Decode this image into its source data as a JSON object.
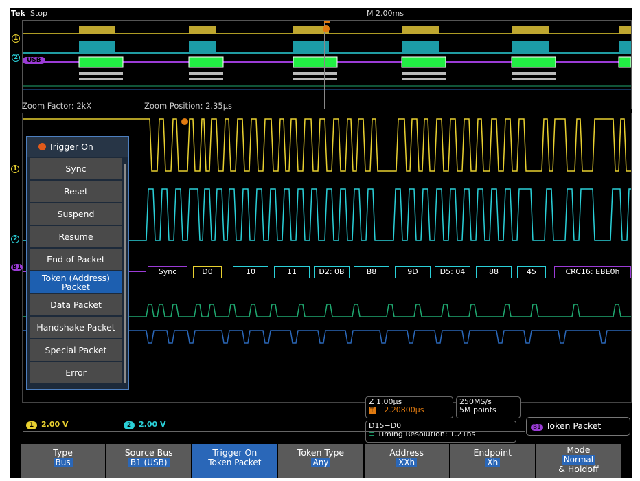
{
  "top_bar": {
    "brand": "Tek",
    "acq_state": "Stop",
    "horizontal_scale": "M 2.00ms"
  },
  "overview": {
    "bus_label": "USB"
  },
  "zoom": {
    "factor": "Zoom Factor: 2kX",
    "position": "Zoom Position: 2.35µs"
  },
  "bus_decode": [
    "Sync",
    "D0",
    "10",
    "11",
    "D2: 0B",
    "B8",
    "9D",
    "D5: 04",
    "88",
    "45",
    "CRC16: EBE0h"
  ],
  "trigger_menu": {
    "title": "Trigger On",
    "items": [
      "Sync",
      "Reset",
      "Suspend",
      "Resume",
      "End of Packet",
      "Token (Address) Packet",
      "Data Packet",
      "Handshake Packet",
      "Special Packet",
      "Error"
    ],
    "selected_index": 5
  },
  "channels": {
    "ch1_label": "1",
    "ch1_volts": "2.00 V",
    "ch2_label": "2",
    "ch2_volts": "2.00 V"
  },
  "readouts": {
    "zoom_scale": "Z 1.00µs",
    "trigger_position": "−2.20800µs",
    "sample_rate": "250MS/s",
    "record_length": "5M points",
    "digital_range": "D15−D0",
    "timing_resolution": "Timing Resolution: 1.21ns"
  },
  "trigger_type": {
    "badge": "B1",
    "label": "Token Packet"
  },
  "softkeys": [
    {
      "label": "Type",
      "value": "Bus"
    },
    {
      "label": "Source Bus",
      "value": "B1 (USB)"
    },
    {
      "label": "Trigger On",
      "value": "Token Packet"
    },
    {
      "label": "Token Type",
      "value": "Any"
    },
    {
      "label": "Address",
      "value": "XXh"
    },
    {
      "label": "Endpoint",
      "value": "Xh"
    },
    {
      "label": "Mode",
      "value": "Normal",
      "value2": "& Holdoff"
    }
  ],
  "colors": {
    "ch1": "#e8d030",
    "ch2": "#2ad0d8",
    "bus": "#9b3bd6",
    "digital": "#1fa870",
    "menu_sel": "#1d5fb0"
  }
}
